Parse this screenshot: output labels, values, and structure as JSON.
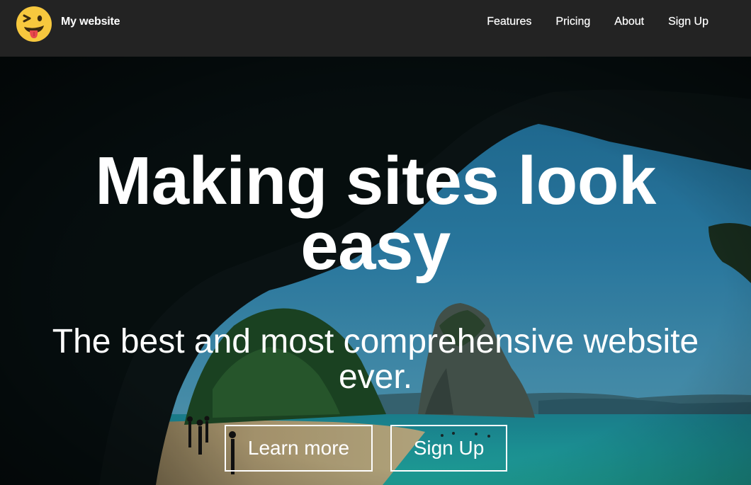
{
  "header": {
    "logo_icon": "winking-tongue-emoji-icon",
    "brand": "My website",
    "nav": [
      {
        "label": "Features"
      },
      {
        "label": "Pricing"
      },
      {
        "label": "About"
      },
      {
        "label": "Sign Up"
      }
    ]
  },
  "hero": {
    "title": "Making sites look easy",
    "subtitle": "The best and most comprehensive website ever.",
    "buttons": [
      {
        "label": "Learn more"
      },
      {
        "label": "Sign Up"
      }
    ]
  },
  "colors": {
    "navbar": "#232323",
    "text": "#ffffff",
    "logo_yellow": "#f7c83e"
  }
}
